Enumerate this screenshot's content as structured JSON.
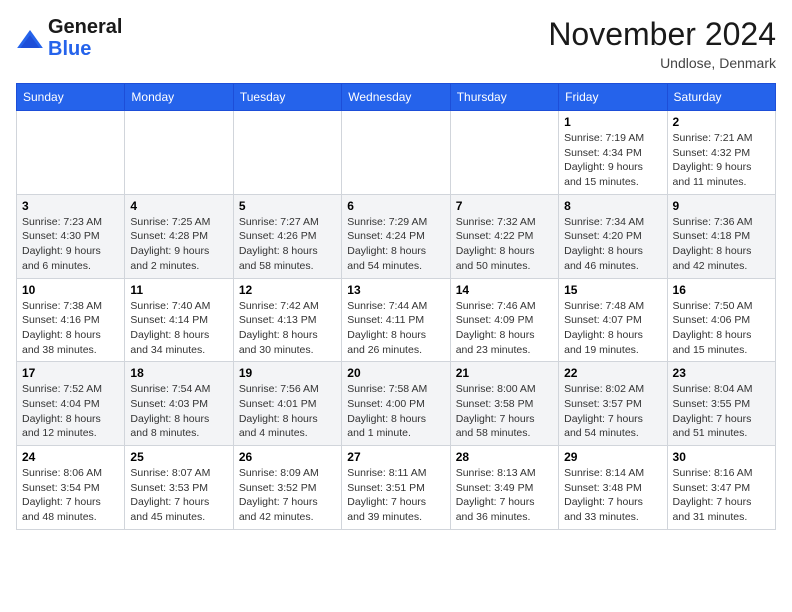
{
  "logo": {
    "line1": "General",
    "line2": "Blue"
  },
  "header": {
    "month": "November 2024",
    "location": "Undlose, Denmark"
  },
  "weekdays": [
    "Sunday",
    "Monday",
    "Tuesday",
    "Wednesday",
    "Thursday",
    "Friday",
    "Saturday"
  ],
  "weeks": [
    [
      {
        "day": "",
        "sunrise": "",
        "sunset": "",
        "daylight": ""
      },
      {
        "day": "",
        "sunrise": "",
        "sunset": "",
        "daylight": ""
      },
      {
        "day": "",
        "sunrise": "",
        "sunset": "",
        "daylight": ""
      },
      {
        "day": "",
        "sunrise": "",
        "sunset": "",
        "daylight": ""
      },
      {
        "day": "",
        "sunrise": "",
        "sunset": "",
        "daylight": ""
      },
      {
        "day": "1",
        "sunrise": "Sunrise: 7:19 AM",
        "sunset": "Sunset: 4:34 PM",
        "daylight": "Daylight: 9 hours and 15 minutes."
      },
      {
        "day": "2",
        "sunrise": "Sunrise: 7:21 AM",
        "sunset": "Sunset: 4:32 PM",
        "daylight": "Daylight: 9 hours and 11 minutes."
      }
    ],
    [
      {
        "day": "3",
        "sunrise": "Sunrise: 7:23 AM",
        "sunset": "Sunset: 4:30 PM",
        "daylight": "Daylight: 9 hours and 6 minutes."
      },
      {
        "day": "4",
        "sunrise": "Sunrise: 7:25 AM",
        "sunset": "Sunset: 4:28 PM",
        "daylight": "Daylight: 9 hours and 2 minutes."
      },
      {
        "day": "5",
        "sunrise": "Sunrise: 7:27 AM",
        "sunset": "Sunset: 4:26 PM",
        "daylight": "Daylight: 8 hours and 58 minutes."
      },
      {
        "day": "6",
        "sunrise": "Sunrise: 7:29 AM",
        "sunset": "Sunset: 4:24 PM",
        "daylight": "Daylight: 8 hours and 54 minutes."
      },
      {
        "day": "7",
        "sunrise": "Sunrise: 7:32 AM",
        "sunset": "Sunset: 4:22 PM",
        "daylight": "Daylight: 8 hours and 50 minutes."
      },
      {
        "day": "8",
        "sunrise": "Sunrise: 7:34 AM",
        "sunset": "Sunset: 4:20 PM",
        "daylight": "Daylight: 8 hours and 46 minutes."
      },
      {
        "day": "9",
        "sunrise": "Sunrise: 7:36 AM",
        "sunset": "Sunset: 4:18 PM",
        "daylight": "Daylight: 8 hours and 42 minutes."
      }
    ],
    [
      {
        "day": "10",
        "sunrise": "Sunrise: 7:38 AM",
        "sunset": "Sunset: 4:16 PM",
        "daylight": "Daylight: 8 hours and 38 minutes."
      },
      {
        "day": "11",
        "sunrise": "Sunrise: 7:40 AM",
        "sunset": "Sunset: 4:14 PM",
        "daylight": "Daylight: 8 hours and 34 minutes."
      },
      {
        "day": "12",
        "sunrise": "Sunrise: 7:42 AM",
        "sunset": "Sunset: 4:13 PM",
        "daylight": "Daylight: 8 hours and 30 minutes."
      },
      {
        "day": "13",
        "sunrise": "Sunrise: 7:44 AM",
        "sunset": "Sunset: 4:11 PM",
        "daylight": "Daylight: 8 hours and 26 minutes."
      },
      {
        "day": "14",
        "sunrise": "Sunrise: 7:46 AM",
        "sunset": "Sunset: 4:09 PM",
        "daylight": "Daylight: 8 hours and 23 minutes."
      },
      {
        "day": "15",
        "sunrise": "Sunrise: 7:48 AM",
        "sunset": "Sunset: 4:07 PM",
        "daylight": "Daylight: 8 hours and 19 minutes."
      },
      {
        "day": "16",
        "sunrise": "Sunrise: 7:50 AM",
        "sunset": "Sunset: 4:06 PM",
        "daylight": "Daylight: 8 hours and 15 minutes."
      }
    ],
    [
      {
        "day": "17",
        "sunrise": "Sunrise: 7:52 AM",
        "sunset": "Sunset: 4:04 PM",
        "daylight": "Daylight: 8 hours and 12 minutes."
      },
      {
        "day": "18",
        "sunrise": "Sunrise: 7:54 AM",
        "sunset": "Sunset: 4:03 PM",
        "daylight": "Daylight: 8 hours and 8 minutes."
      },
      {
        "day": "19",
        "sunrise": "Sunrise: 7:56 AM",
        "sunset": "Sunset: 4:01 PM",
        "daylight": "Daylight: 8 hours and 4 minutes."
      },
      {
        "day": "20",
        "sunrise": "Sunrise: 7:58 AM",
        "sunset": "Sunset: 4:00 PM",
        "daylight": "Daylight: 8 hours and 1 minute."
      },
      {
        "day": "21",
        "sunrise": "Sunrise: 8:00 AM",
        "sunset": "Sunset: 3:58 PM",
        "daylight": "Daylight: 7 hours and 58 minutes."
      },
      {
        "day": "22",
        "sunrise": "Sunrise: 8:02 AM",
        "sunset": "Sunset: 3:57 PM",
        "daylight": "Daylight: 7 hours and 54 minutes."
      },
      {
        "day": "23",
        "sunrise": "Sunrise: 8:04 AM",
        "sunset": "Sunset: 3:55 PM",
        "daylight": "Daylight: 7 hours and 51 minutes."
      }
    ],
    [
      {
        "day": "24",
        "sunrise": "Sunrise: 8:06 AM",
        "sunset": "Sunset: 3:54 PM",
        "daylight": "Daylight: 7 hours and 48 minutes."
      },
      {
        "day": "25",
        "sunrise": "Sunrise: 8:07 AM",
        "sunset": "Sunset: 3:53 PM",
        "daylight": "Daylight: 7 hours and 45 minutes."
      },
      {
        "day": "26",
        "sunrise": "Sunrise: 8:09 AM",
        "sunset": "Sunset: 3:52 PM",
        "daylight": "Daylight: 7 hours and 42 minutes."
      },
      {
        "day": "27",
        "sunrise": "Sunrise: 8:11 AM",
        "sunset": "Sunset: 3:51 PM",
        "daylight": "Daylight: 7 hours and 39 minutes."
      },
      {
        "day": "28",
        "sunrise": "Sunrise: 8:13 AM",
        "sunset": "Sunset: 3:49 PM",
        "daylight": "Daylight: 7 hours and 36 minutes."
      },
      {
        "day": "29",
        "sunrise": "Sunrise: 8:14 AM",
        "sunset": "Sunset: 3:48 PM",
        "daylight": "Daylight: 7 hours and 33 minutes."
      },
      {
        "day": "30",
        "sunrise": "Sunrise: 8:16 AM",
        "sunset": "Sunset: 3:47 PM",
        "daylight": "Daylight: 7 hours and 31 minutes."
      }
    ]
  ]
}
